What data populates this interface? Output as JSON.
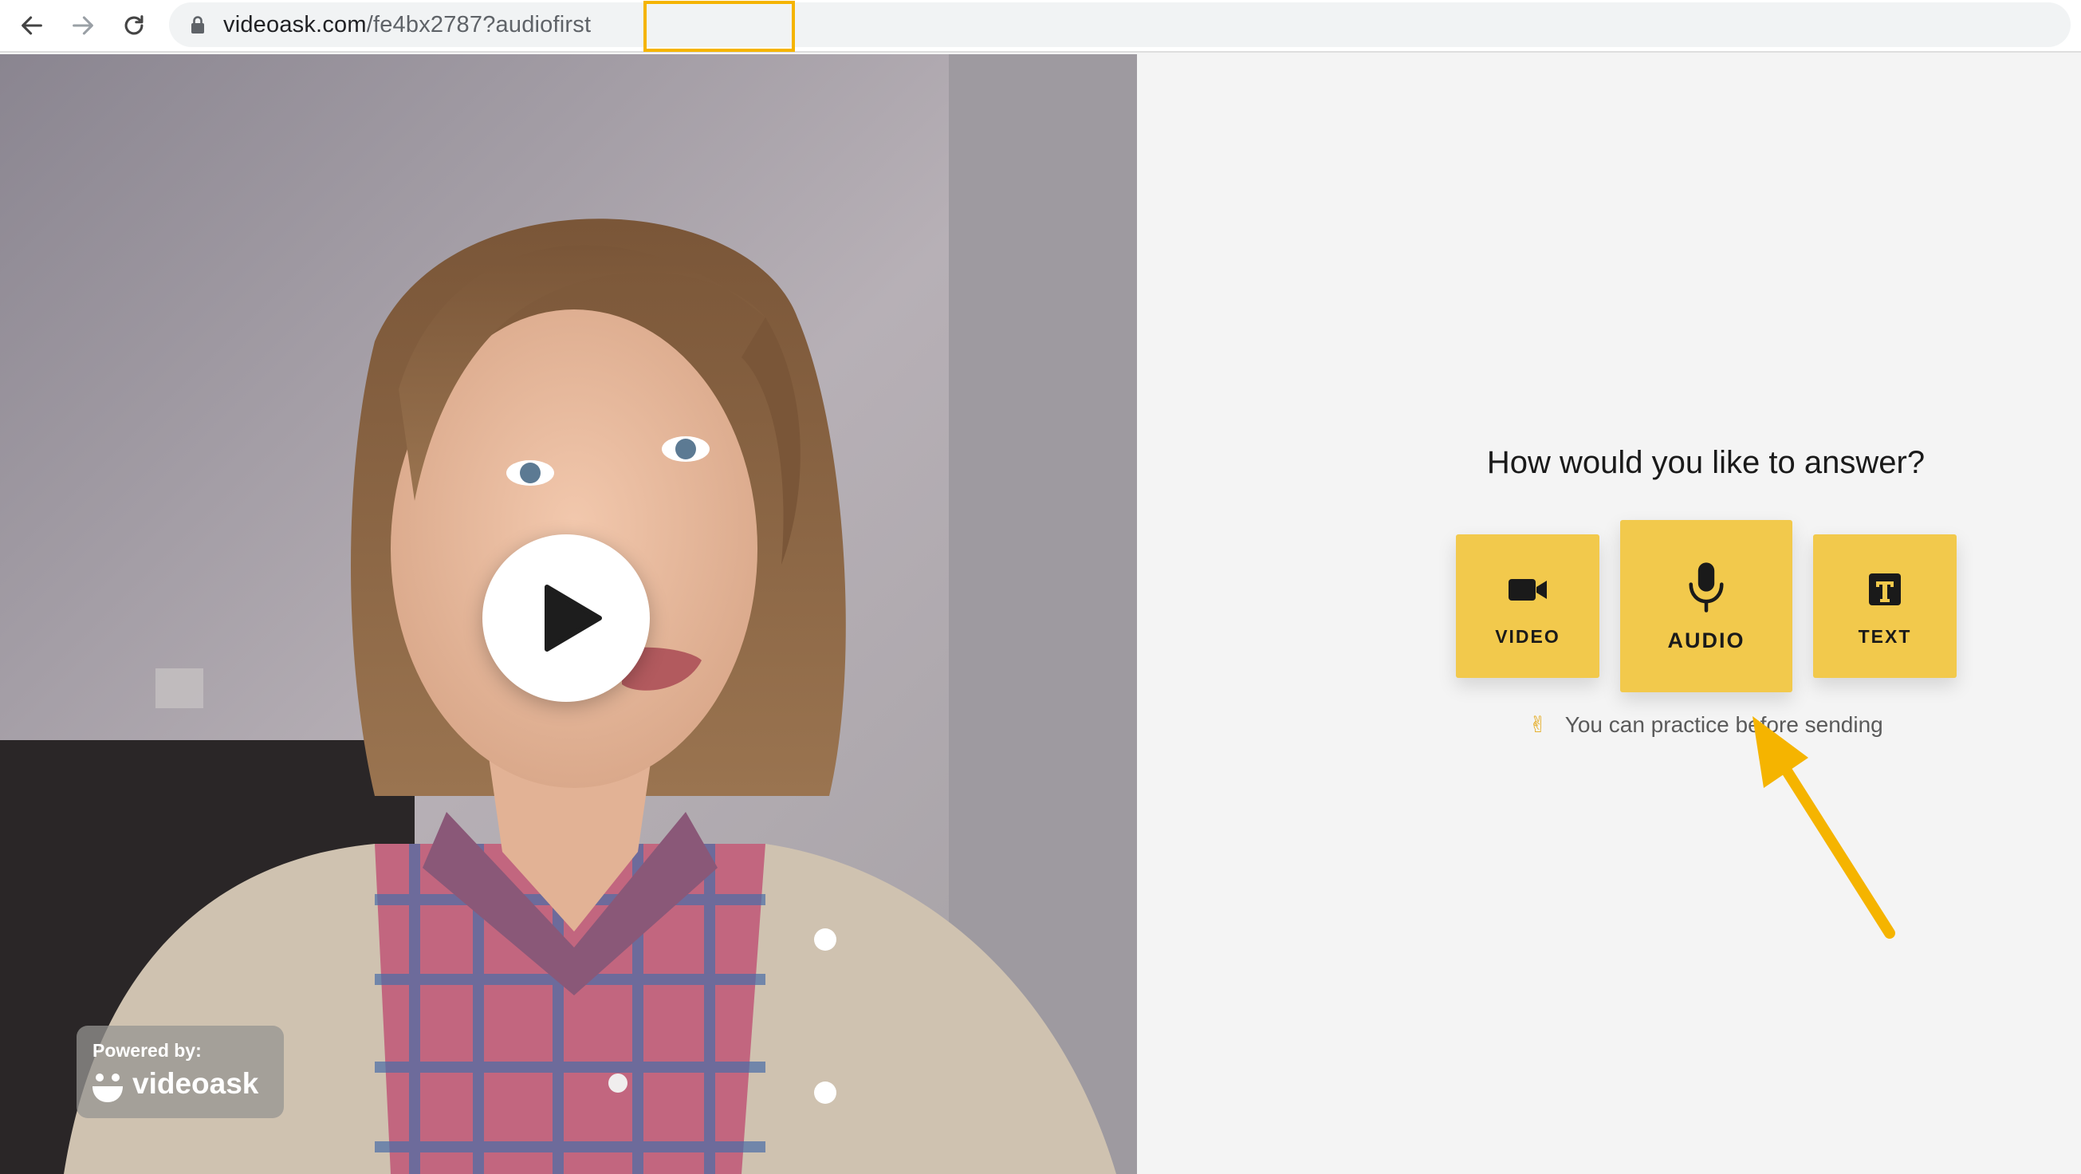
{
  "browser": {
    "url_domain": "videoask.com",
    "url_path": "/fe4bx278",
    "url_query": "7?audiofirst"
  },
  "video": {
    "powered_by": "Powered by:",
    "brand": "videoask"
  },
  "answer": {
    "prompt": "How would you like to answer?",
    "options": [
      {
        "label": "VIDEO",
        "icon": "video-camera-icon"
      },
      {
        "label": "AUDIO",
        "icon": "microphone-icon"
      },
      {
        "label": "TEXT",
        "icon": "text-t-icon"
      }
    ],
    "practice_emoji": "✌",
    "practice_text": "You can practice before sending"
  },
  "colors": {
    "accent_yellow": "#f2c94c",
    "highlight_orange": "#f5b400",
    "background": "#f4f4f4"
  }
}
